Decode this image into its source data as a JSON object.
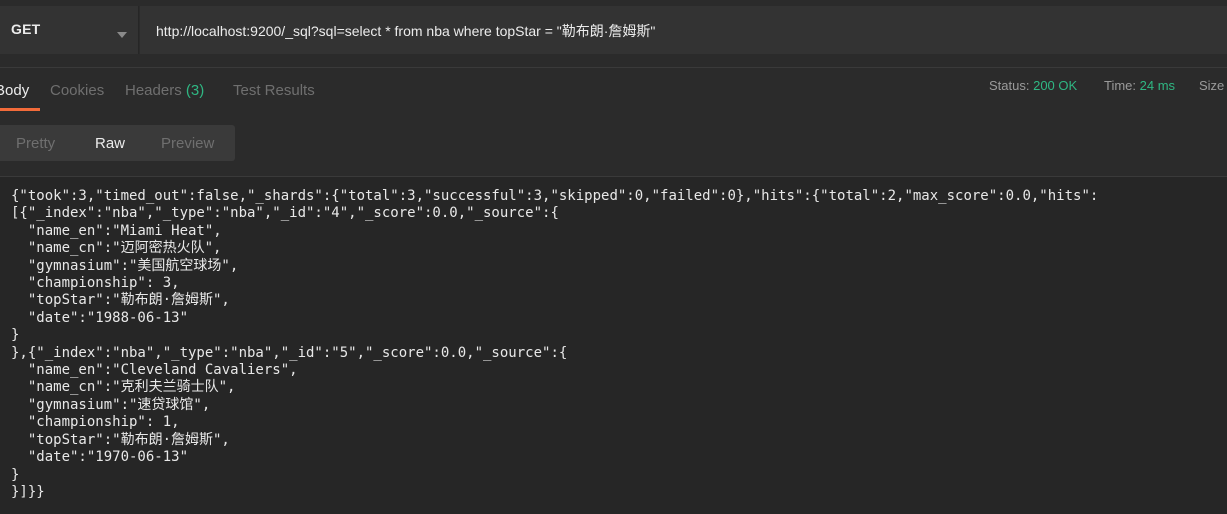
{
  "request": {
    "method": "GET",
    "url": "http://localhost:9200/_sql?sql=select * from nba where topStar  = \"勒布朗·詹姆斯\""
  },
  "tabs": {
    "body": "Body",
    "cookies": "Cookies",
    "headers": "Headers",
    "headers_count": "(3)",
    "test_results": "Test Results"
  },
  "status": {
    "status_label": "Status:",
    "status_value": "200 OK",
    "time_label": "Time:",
    "time_value": "24 ms",
    "size_label": "Size"
  },
  "format": {
    "pretty": "Pretty",
    "raw": "Raw",
    "preview": "Preview",
    "selected": "Raw"
  },
  "response": {
    "lines": [
      "{\"took\":3,\"timed_out\":false,\"_shards\":{\"total\":3,\"successful\":3,\"skipped\":0,\"failed\":0},\"hits\":{\"total\":2,\"max_score\":0.0,\"hits\":",
      "[{\"_index\":\"nba\",\"_type\":\"nba\",\"_id\":\"4\",\"_score\":0.0,\"_source\":{",
      "  \"name_en\":\"Miami Heat\",",
      "  \"name_cn\":\"迈阿密热火队\",",
      "  \"gymnasium\":\"美国航空球场\",",
      "  \"championship\": 3,",
      "  \"topStar\":\"勒布朗·詹姆斯\",",
      "  \"date\":\"1988-06-13\"",
      "}",
      "},{\"_index\":\"nba\",\"_type\":\"nba\",\"_id\":\"5\",\"_score\":0.0,\"_source\":{",
      "  \"name_en\":\"Cleveland Cavaliers\",",
      "  \"name_cn\":\"克利夫兰骑士队\",",
      "  \"gymnasium\":\"速贷球馆\",",
      "  \"championship\": 1,",
      "  \"topStar\":\"勒布朗·詹姆斯\",",
      "  \"date\":\"1970-06-13\"",
      "}",
      "}]}}"
    ]
  },
  "colors": {
    "accent": "#f26b3a",
    "success": "#2fb783",
    "background": "#2b2b2b"
  }
}
